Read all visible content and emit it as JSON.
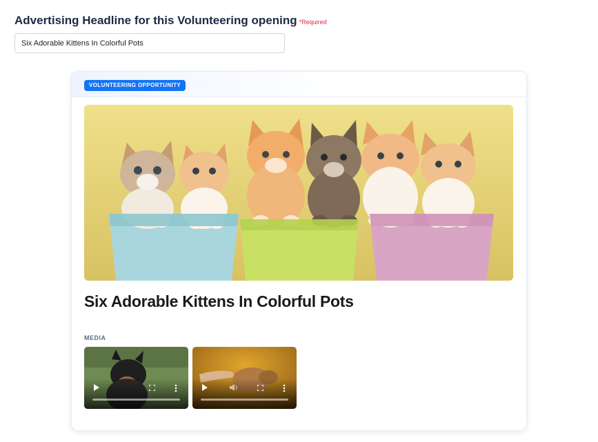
{
  "form": {
    "label": "Advertising Headline for this Volunteering opening",
    "required": "*Required",
    "headline_value": "Six Adorable Kittens In Colorful Pots"
  },
  "card": {
    "badge": "VOLUNTEERING OPPORTUNITY",
    "title": "Six Adorable Kittens In Colorful Pots",
    "media_label": "MEDIA",
    "videos": [
      {
        "controls": [
          "play-icon",
          "fullscreen-icon",
          "more-icon"
        ]
      },
      {
        "controls": [
          "play-icon",
          "volume-icon",
          "fullscreen-icon",
          "more-icon"
        ]
      }
    ]
  },
  "colors": {
    "badge": "#1474f5",
    "label": "#1c2a44",
    "required": "#e0243a"
  }
}
